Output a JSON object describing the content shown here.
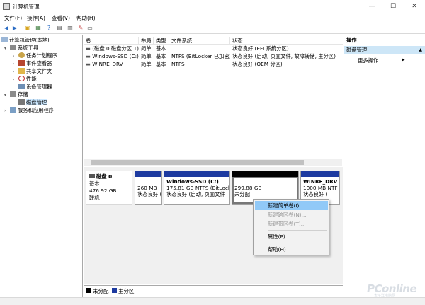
{
  "window": {
    "title": "计算机管理",
    "minimize": "—",
    "maximize": "☐",
    "close": "✕"
  },
  "menu": [
    "文件(F)",
    "操作(A)",
    "查看(V)",
    "帮助(H)"
  ],
  "toolbar": {
    "icons": [
      "back-icon",
      "forward-icon",
      "folder-up-icon",
      "properties-icon",
      "help-icon",
      "list-icon",
      "console-icon",
      "export-icon",
      "view-icon"
    ]
  },
  "tree": {
    "root": "计算机管理(本地)",
    "system_tools": "系统工具",
    "task_scheduler": "任务计划程序",
    "event_viewer": "事件查看器",
    "shared_folders": "共享文件夹",
    "performance": "性能",
    "device_manager": "设备管理器",
    "storage": "存储",
    "disk_management": "磁盘管理",
    "services": "服务和应用程序"
  },
  "volumes": {
    "columns": [
      "卷",
      "布局",
      "类型",
      "文件系统",
      "状态"
    ],
    "rows": [
      {
        "volume": "(磁盘 0 磁盘分区 1)",
        "layout": "简单",
        "type": "基本",
        "fs": "",
        "status": "状态良好 (EFI 系统分区)"
      },
      {
        "volume": "Windows-SSD (C:)",
        "layout": "简单",
        "type": "基本",
        "fs": "NTFS (BitLocker 已加密)",
        "status": "状态良好 (启动, 页面文件, 故障转储, 主分区)"
      },
      {
        "volume": "WINRE_DRV",
        "layout": "简单",
        "type": "基本",
        "fs": "NTFS",
        "status": "状态良好 (OEM 分区)"
      }
    ]
  },
  "disk0": {
    "name": "磁盘 0",
    "type": "基本",
    "size": "476.92 GB",
    "state": "联机"
  },
  "partitions": [
    {
      "name": "",
      "size": "260 MB",
      "status": "状态良好 (",
      "bar": "#1d3aa0"
    },
    {
      "name": "Windows-SSD  (C:)",
      "size": "175.81 GB NTFS (BitLocke",
      "status": "状态良好 (启动, 页面文件",
      "bar": "#1d3aa0"
    },
    {
      "name": "",
      "size": "299.88 GB",
      "status": "未分配",
      "bar": "#000000"
    },
    {
      "name": "WINRE_DRV",
      "size": "1000 MB NTF",
      "status": "状态良好 (",
      "bar": "#1d3aa0"
    }
  ],
  "legend": [
    {
      "label": "未分配",
      "color": "#000000"
    },
    {
      "label": "主分区",
      "color": "#1d3aa0"
    }
  ],
  "actions": {
    "header": "操作",
    "selected": "磁盘管理",
    "more": "更多操作"
  },
  "context_menu": {
    "items": [
      {
        "label": "新建简单卷(I)...",
        "state": "highlighted"
      },
      {
        "label": "新建跨区卷(N)...",
        "state": "disabled"
      },
      {
        "label": "新建带区卷(T)...",
        "state": "disabled"
      },
      {
        "label": "属性(P)",
        "state": "enabled"
      },
      {
        "label": "帮助(H)",
        "state": "enabled"
      }
    ]
  },
  "watermark": {
    "brand": "PConline",
    "sub": "太平洋电脑网"
  }
}
